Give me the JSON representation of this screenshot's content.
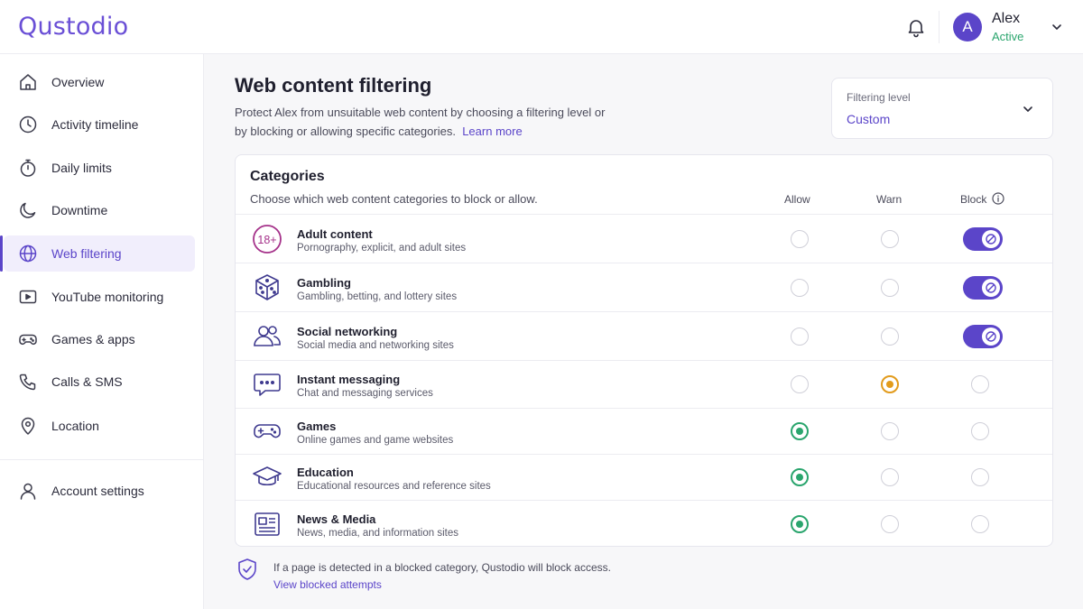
{
  "header": {
    "logo": "Qustodio",
    "user": {
      "initial": "A",
      "name": "Alex",
      "status": "Active"
    },
    "colors": {
      "brand": "#5b45c9",
      "active_status": "#2aa56d"
    }
  },
  "sidebar": {
    "items": [
      {
        "label": "Overview",
        "icon": "home-icon"
      },
      {
        "label": "Activity timeline",
        "icon": "clock-icon"
      },
      {
        "label": "Daily limits",
        "icon": "stopwatch-icon"
      },
      {
        "label": "Downtime",
        "icon": "moon-icon"
      },
      {
        "label": "Web filtering",
        "icon": "globe-icon",
        "active": true
      },
      {
        "label": "YouTube monitoring",
        "icon": "play-icon"
      },
      {
        "label": "Games & apps",
        "icon": "gamepad-icon"
      },
      {
        "label": "Calls & SMS",
        "icon": "phone-icon"
      },
      {
        "label": "Location",
        "icon": "location-pin-icon"
      }
    ],
    "account": {
      "label": "Account settings",
      "icon": "user-icon"
    }
  },
  "main": {
    "title": "Web content filtering",
    "description": "Protect Alex from unsuitable web content by choosing a filtering level or by blocking or allowing specific categories.",
    "learn_more": "Learn more",
    "filtering_level": {
      "label": "Filtering level",
      "value": "Custom"
    },
    "categories": {
      "title": "Categories",
      "subtitle": "Choose which web content categories to block or allow.",
      "columns": {
        "allow": "Allow",
        "warn": "Warn",
        "block": "Block"
      },
      "rows": [
        {
          "name": "Adult content",
          "desc": "Pornography, explicit, and adult sites",
          "icon": "adult-18-icon",
          "state": "block"
        },
        {
          "name": "Gambling",
          "desc": "Gambling, betting, and lottery sites",
          "icon": "dice-icon",
          "state": "block"
        },
        {
          "name": "Social networking",
          "desc": "Social media and networking sites",
          "icon": "people-icon",
          "state": "block"
        },
        {
          "name": "Instant messaging",
          "desc": "Chat and messaging services",
          "icon": "chat-bubble-icon",
          "state": "warn"
        },
        {
          "name": "Games",
          "desc": "Online games and game websites",
          "icon": "gamepad-icon",
          "state": "allow"
        },
        {
          "name": "Education",
          "desc": "Educational resources and reference sites",
          "icon": "graduation-cap-icon",
          "state": "allow"
        },
        {
          "name": "News & Media",
          "desc": "News, media, and information sites",
          "icon": "newspaper-icon",
          "state": "allow"
        }
      ]
    },
    "footer": {
      "text": "If a page is detected in a blocked category, Qustodio will block access.",
      "link": "View blocked attempts"
    }
  }
}
